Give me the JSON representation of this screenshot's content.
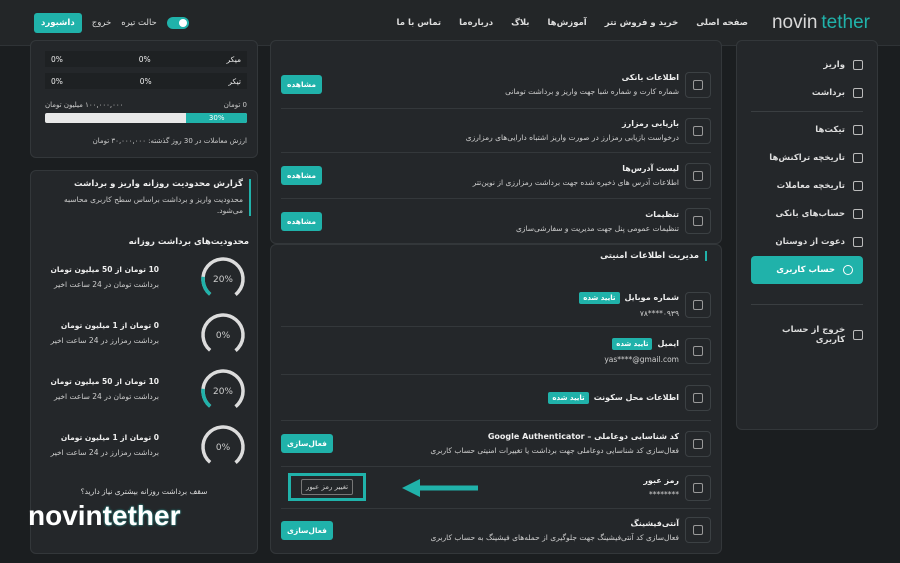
{
  "header": {
    "brand_a": "novin",
    "brand_b": "tether",
    "nav": [
      "صفحه اصلی",
      "خرید و فروش تتر",
      "آموزش‌ها",
      "بلاگ",
      "درباره‌ما",
      "تماس با ما"
    ],
    "dark_mode": "حالت تیره",
    "logout": "خروج",
    "dashboard": "داشبورد"
  },
  "sidebar": {
    "items": [
      "واریز",
      "برداشت",
      "تیکت‌ها",
      "تاریخچه تراکنش‌ها",
      "تاریخچه معاملات",
      "حساب‌های بانکی",
      "دعوت از دوستان",
      "حساب کاربری"
    ],
    "exit": "خروج از حساب کاربری"
  },
  "settings": {
    "view": "مشاهده",
    "rows": [
      {
        "title": "اطلاعات بانکی",
        "desc": "شماره کارت و شماره شبا جهت واریز و برداشت تومانی"
      },
      {
        "title": "بازیابی رمزارز",
        "desc": "درخواست بازیابی رمزارز در صورت واریز اشتباه دارایی‌های رمزارزی"
      },
      {
        "title": "لیست آدرس‌ها",
        "desc": "اطلاعات آدرس های ذخیره شده جهت برداشت رمزارزی از نوین‌تتر"
      },
      {
        "title": "تنظیمات",
        "desc": "تنظیمات عمومی پنل جهت مدیریت و سفارشی‌سازی"
      }
    ]
  },
  "security": {
    "title": "مدیریت اطلاعات امنیتی",
    "verified": "تایید شده",
    "activate": "فعال‌سازی",
    "mobile": {
      "title": "شماره موبایل",
      "value": "۰۹۳۹****۷۸"
    },
    "email": {
      "title": "ایمیل",
      "value": "yas****@gmail.com"
    },
    "address": {
      "title": "اطلاعات محل سکونت"
    },
    "ga": {
      "title": "کد شناسایی دوعاملی – Google Authenticator",
      "desc": "فعال‌سازی کد شناسایی دوعاملی جهت برداشت یا تغییرات امنیتی حساب کاربری"
    },
    "password": {
      "title": "رمز عبور",
      "value": "********",
      "button": "تغییر رمز عبور"
    },
    "antiphish": {
      "title": "آنتی‌فیشینگ",
      "desc": "فعال‌سازی کد آنتی‌فیشینگ جهت جلوگیری از حمله‌های فیشینگ به حساب کاربری"
    }
  },
  "summary": {
    "micro_label": "میکر",
    "taker_label": "تیکر",
    "percent": "0%",
    "zero": "0 تومان",
    "max": "۱۰۰,۰۰۰,۰۰۰ میلیون تومان",
    "progress_label": "30%",
    "progress": 0.3,
    "note": "ارزش معاملات در 30 روز گذشته: ۳۰,۰۰۰,۰۰۰ تومان"
  },
  "limits": {
    "report_title": "گزارش محدودیت روزانه واریز و برداشت",
    "report_desc": "محدودیت واریز و برداشت براساس سطح کاربری محاسبه می‌شود.",
    "section": "محدودیت‌های برداشت روزانه",
    "items": [
      {
        "amount": "10 تومان از 50 میلیون تومان",
        "desc": "برداشت تومان در 24 ساعت اخیر",
        "pct": "20%",
        "val": 0.2
      },
      {
        "amount": "0 تومان از 1 میلیون تومان",
        "desc": "برداشت رمزارز در 24 ساعت اخیر",
        "pct": "0%",
        "val": 0
      },
      {
        "amount": "10 تومان از 50 میلیون تومان",
        "desc": "برداشت تومان در 24 ساعت اخیر",
        "pct": "20%",
        "val": 0.2
      },
      {
        "amount": "0 تومان از 1 میلیون تومان",
        "desc": "برداشت رمزارز در 24 ساعت اخیر",
        "pct": "0%",
        "val": 0
      }
    ],
    "more": "سقف برداشت روزانه بیشتری نیاز دارید؟"
  },
  "colors": {
    "accent": "#20b2aa",
    "bg": "#1b1e20",
    "panel": "#24272a"
  }
}
